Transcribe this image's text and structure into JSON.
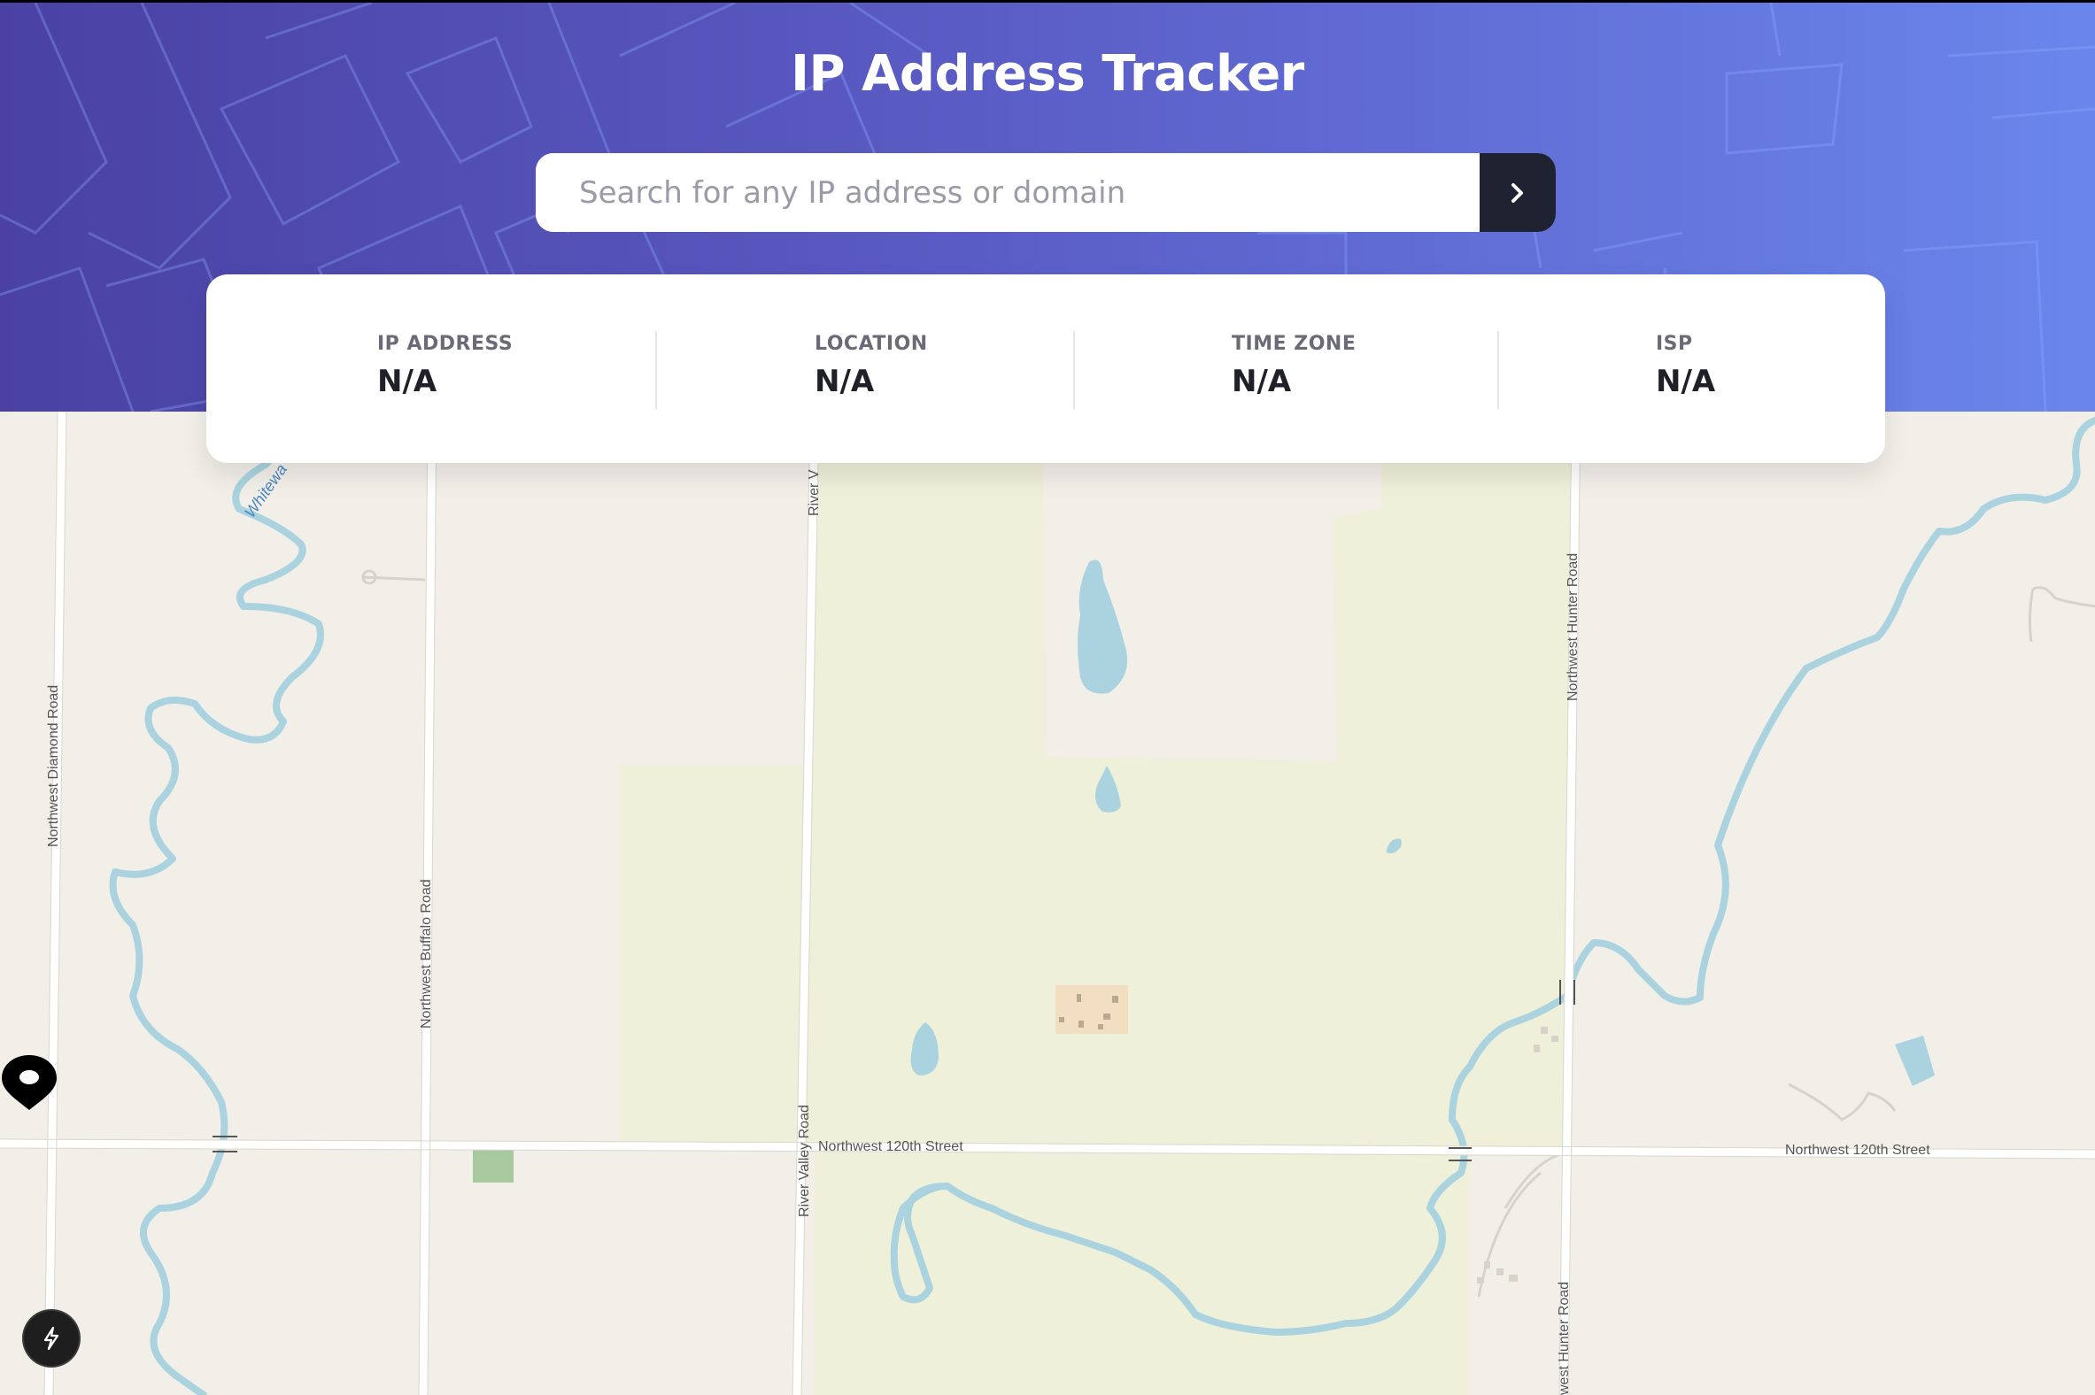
{
  "header": {
    "title": "IP Address Tracker",
    "search_placeholder": "Search for any IP address or domain",
    "search_value": "",
    "submit_icon": "chevron-right-icon"
  },
  "info": [
    {
      "label": "IP ADDRESS",
      "value": "N/A"
    },
    {
      "label": "LOCATION",
      "value": "N/A"
    },
    {
      "label": "TIME ZONE",
      "value": "N/A"
    },
    {
      "label": "ISP",
      "value": "N/A"
    }
  ],
  "map": {
    "streets": {
      "diamond": "Northwest Diamond Road",
      "buffalo": "Northwest Buffalo Road",
      "river_valley_top": "River V",
      "river_valley_bottom": "River Valley Road",
      "hunter_top": "Northwest Hunter Road",
      "hunter_bottom": "west Hunter Road",
      "street_120_left": "Northwest 120th Street",
      "street_120_right": "Northwest 120th Street",
      "river": "Whitewa"
    },
    "marker_icon": "location-pin-icon"
  },
  "dev_badge_icon": "lightning-bolt-icon",
  "colors": {
    "header_start": "#4a41a3",
    "header_end": "#6a86ec",
    "button": "#1f2230",
    "water": "#aad3df",
    "park": "#eef0d9",
    "land": "#f2efe9"
  }
}
